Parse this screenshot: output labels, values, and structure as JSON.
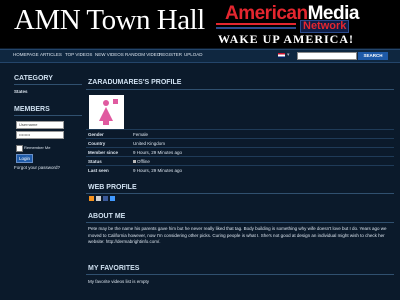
{
  "header": {
    "site_title": "AMN Town Hall",
    "logo": {
      "line1_a": "American",
      "line1_b": "Media",
      "line2": "Network",
      "line3": "WAKE UP AMERICA!"
    }
  },
  "nav": {
    "items": [
      "HOMEPAGE",
      "ARTICLES",
      "TOP VIDEOS",
      "NEW VIDEOS",
      "RANDOM VIDEO",
      "REGISTER",
      "UPLOAD"
    ],
    "search_button": "SEARCH",
    "search_value": ""
  },
  "sidebar": {
    "category_heading": "CATEGORY",
    "category_item": "States",
    "members_heading": "MEMBERS",
    "username_placeholder": "Username",
    "password_value": "••••••••",
    "remember_me": "Remember Me",
    "login_button": "Login",
    "forgot_link": "Forgot your password?"
  },
  "profile": {
    "heading": "ZARADUMARES'S PROFILE",
    "rows": [
      {
        "label": "Gender",
        "value": "Female"
      },
      {
        "label": "Country",
        "value": "United Kingdom"
      },
      {
        "label": "Member since",
        "value": "9 Hours, 29 Minutes ago"
      },
      {
        "label": "Status",
        "value": "Offline"
      },
      {
        "label": "Last seen",
        "value": "9 Hours, 29 Minutes ago"
      }
    ]
  },
  "web_profile": {
    "heading": "WEB PROFILE"
  },
  "about": {
    "heading": "ABOUT ME",
    "text": "Pete may be the name his parents gave him but he never really liked that tag. Body building is something why wife doesn't love but I do. Years ago we moved to California however, now I'm considering other picks. Curing people is what I. She's not good at design an individual might wish to check her website: http://dermabrightinfo.com/."
  },
  "favorites": {
    "heading": "MY FAVORITES",
    "text": "My favorite videos list is empty"
  },
  "colors": {
    "accent": "#1e5aa8",
    "background": "#0b1a2b",
    "logo_red": "#e4262f"
  }
}
